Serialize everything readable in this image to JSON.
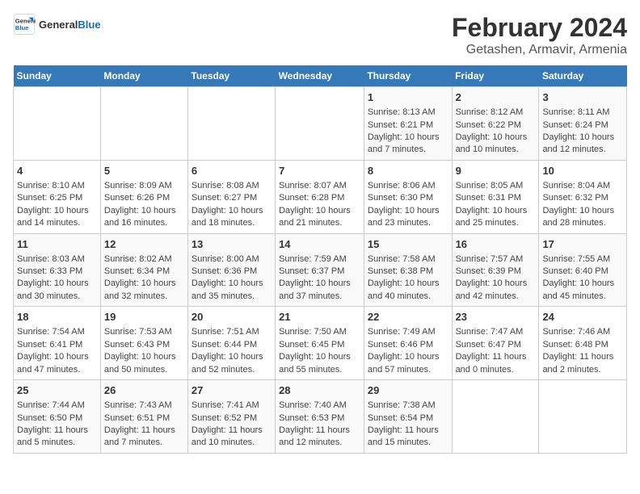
{
  "header": {
    "logo_line1": "General",
    "logo_line2": "Blue",
    "title": "February 2024",
    "subtitle": "Getashen, Armavir, Armenia"
  },
  "weekdays": [
    "Sunday",
    "Monday",
    "Tuesday",
    "Wednesday",
    "Thursday",
    "Friday",
    "Saturday"
  ],
  "weeks": [
    [
      {
        "day": "",
        "info": ""
      },
      {
        "day": "",
        "info": ""
      },
      {
        "day": "",
        "info": ""
      },
      {
        "day": "",
        "info": ""
      },
      {
        "day": "1",
        "info": "Sunrise: 8:13 AM\nSunset: 6:21 PM\nDaylight: 10 hours\nand 7 minutes."
      },
      {
        "day": "2",
        "info": "Sunrise: 8:12 AM\nSunset: 6:22 PM\nDaylight: 10 hours\nand 10 minutes."
      },
      {
        "day": "3",
        "info": "Sunrise: 8:11 AM\nSunset: 6:24 PM\nDaylight: 10 hours\nand 12 minutes."
      }
    ],
    [
      {
        "day": "4",
        "info": "Sunrise: 8:10 AM\nSunset: 6:25 PM\nDaylight: 10 hours\nand 14 minutes."
      },
      {
        "day": "5",
        "info": "Sunrise: 8:09 AM\nSunset: 6:26 PM\nDaylight: 10 hours\nand 16 minutes."
      },
      {
        "day": "6",
        "info": "Sunrise: 8:08 AM\nSunset: 6:27 PM\nDaylight: 10 hours\nand 18 minutes."
      },
      {
        "day": "7",
        "info": "Sunrise: 8:07 AM\nSunset: 6:28 PM\nDaylight: 10 hours\nand 21 minutes."
      },
      {
        "day": "8",
        "info": "Sunrise: 8:06 AM\nSunset: 6:30 PM\nDaylight: 10 hours\nand 23 minutes."
      },
      {
        "day": "9",
        "info": "Sunrise: 8:05 AM\nSunset: 6:31 PM\nDaylight: 10 hours\nand 25 minutes."
      },
      {
        "day": "10",
        "info": "Sunrise: 8:04 AM\nSunset: 6:32 PM\nDaylight: 10 hours\nand 28 minutes."
      }
    ],
    [
      {
        "day": "11",
        "info": "Sunrise: 8:03 AM\nSunset: 6:33 PM\nDaylight: 10 hours\nand 30 minutes."
      },
      {
        "day": "12",
        "info": "Sunrise: 8:02 AM\nSunset: 6:34 PM\nDaylight: 10 hours\nand 32 minutes."
      },
      {
        "day": "13",
        "info": "Sunrise: 8:00 AM\nSunset: 6:36 PM\nDaylight: 10 hours\nand 35 minutes."
      },
      {
        "day": "14",
        "info": "Sunrise: 7:59 AM\nSunset: 6:37 PM\nDaylight: 10 hours\nand 37 minutes."
      },
      {
        "day": "15",
        "info": "Sunrise: 7:58 AM\nSunset: 6:38 PM\nDaylight: 10 hours\nand 40 minutes."
      },
      {
        "day": "16",
        "info": "Sunrise: 7:57 AM\nSunset: 6:39 PM\nDaylight: 10 hours\nand 42 minutes."
      },
      {
        "day": "17",
        "info": "Sunrise: 7:55 AM\nSunset: 6:40 PM\nDaylight: 10 hours\nand 45 minutes."
      }
    ],
    [
      {
        "day": "18",
        "info": "Sunrise: 7:54 AM\nSunset: 6:41 PM\nDaylight: 10 hours\nand 47 minutes."
      },
      {
        "day": "19",
        "info": "Sunrise: 7:53 AM\nSunset: 6:43 PM\nDaylight: 10 hours\nand 50 minutes."
      },
      {
        "day": "20",
        "info": "Sunrise: 7:51 AM\nSunset: 6:44 PM\nDaylight: 10 hours\nand 52 minutes."
      },
      {
        "day": "21",
        "info": "Sunrise: 7:50 AM\nSunset: 6:45 PM\nDaylight: 10 hours\nand 55 minutes."
      },
      {
        "day": "22",
        "info": "Sunrise: 7:49 AM\nSunset: 6:46 PM\nDaylight: 10 hours\nand 57 minutes."
      },
      {
        "day": "23",
        "info": "Sunrise: 7:47 AM\nSunset: 6:47 PM\nDaylight: 11 hours\nand 0 minutes."
      },
      {
        "day": "24",
        "info": "Sunrise: 7:46 AM\nSunset: 6:48 PM\nDaylight: 11 hours\nand 2 minutes."
      }
    ],
    [
      {
        "day": "25",
        "info": "Sunrise: 7:44 AM\nSunset: 6:50 PM\nDaylight: 11 hours\nand 5 minutes."
      },
      {
        "day": "26",
        "info": "Sunrise: 7:43 AM\nSunset: 6:51 PM\nDaylight: 11 hours\nand 7 minutes."
      },
      {
        "day": "27",
        "info": "Sunrise: 7:41 AM\nSunset: 6:52 PM\nDaylight: 11 hours\nand 10 minutes."
      },
      {
        "day": "28",
        "info": "Sunrise: 7:40 AM\nSunset: 6:53 PM\nDaylight: 11 hours\nand 12 minutes."
      },
      {
        "day": "29",
        "info": "Sunrise: 7:38 AM\nSunset: 6:54 PM\nDaylight: 11 hours\nand 15 minutes."
      },
      {
        "day": "",
        "info": ""
      },
      {
        "day": "",
        "info": ""
      }
    ]
  ]
}
